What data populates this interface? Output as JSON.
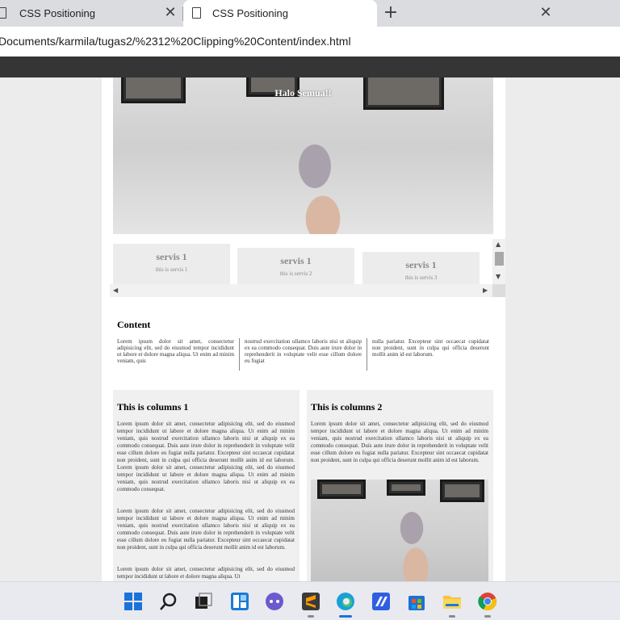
{
  "browser": {
    "tabs": [
      {
        "title": "CSS Positioning",
        "active": false
      },
      {
        "title": "CSS Positioning",
        "active": true
      }
    ],
    "close_glyph": "✕",
    "new_tab_glyph": "+",
    "url": "Documents/karmila/tugas2/%2312%20Clipping%20Content/index.html"
  },
  "page": {
    "hero_title": "Halo Semua!!",
    "services": [
      {
        "title": "servis 1",
        "subtitle": "this is servis 1"
      },
      {
        "title": "servis 1",
        "subtitle": "this is servis 2"
      },
      {
        "title": "servis 1",
        "subtitle": "this is servis 3"
      }
    ],
    "content": {
      "title": "Content",
      "columns": [
        "Lorem ipsum dolor sit amet, consectetur adipisicing elit, sed do eiusmod tempor incididunt ut labore et dolore magna aliqua. Ut enim ad minim veniam, quis",
        "nostrud exercitation ullamco laboris nisi ut aliquip ex ea commodo consequat. Duis aute irure dolor in reprehenderit in voluptate velit esse cillum dolore eu fugiat",
        "nulla pariatur. Excepteur sint occaecat cupidatat non proident, sunt in culpa qui officia deserunt mollit anim id est laborum."
      ]
    },
    "column1": {
      "title": "This is columns 1",
      "paragraphs": [
        "Lorem ipsum dolor sit amet, consectetur adipisicing elit, sed do eiusmod tempor incididunt ut labore et dolore magna aliqua. Ut enim ad minim veniam, quis nostrud exercitation ullamco laboris nisi ut aliquip ex ea commodo consequat. Duis aute irure dolor in reprehenderit in voluptate velit esse cillum dolore eu fugiat nulla pariatur. Excepteur sint occaecat cupidatat non proident, sunt in culpa qui officia deserunt mollit anim id est laborum. Lorem ipsum dolor sit amet, consectetur adipisicing elit, sed do eiusmod tempor incididunt ut labore et dolore magna aliqua. Ut enim ad minim veniam, quis nostrud exercitation ullamco laboris nisi ut aliquip ex ea commodo consequat.",
        "Lorem ipsum dolor sit amet, consectetur adipisicing elit, sed do eiusmod tempor incididunt ut labore et dolore magna aliqua. Ut enim ad minim veniam, quis nostrud exercitation ullamco laboris nisi ut aliquip ex ea commodo consequat. Duis aute irure dolor in reprehenderit in voluptate velit esse cillum dolore eu fugiat nulla pariatur. Excepteur sint occaecat cupidatat non proident, sunt in culpa qui officia deserunt mollit anim id est laborum.",
        "Lorem ipsum dolor sit amet, consectetur adipisicing elit, sed do eiusmod tempor incididunt ut labore et dolore magna aliqua. Ut"
      ]
    },
    "column2": {
      "title": "This is columns 2",
      "paragraph": "Lorem ipsum dolor sit amet, consectetur adipisicing elit, sed do eiusmod tempor incididunt ut labore et dolore magna aliqua. Ut enim ad minim veniam, quis nostrud exercitation ullamco laboris nisi ut aliquip ex ea commodo consequat. Duis aute irure dolor in reprehenderit in voluptate velit esse cillum dolore eu fugiat nulla pariatur. Excepteur sint occaecat cupidatat non proident, sunt in culpa qui officia deserunt mollit anim id est laborum."
    }
  },
  "scrollbar": {
    "up": "▲",
    "down": "▼",
    "left": "◀",
    "right": "▶"
  },
  "taskbar": {
    "icons": [
      "windows-start-icon",
      "search-icon",
      "task-view-icon",
      "widgets-icon",
      "chat-icon",
      "sublime-text-icon",
      "edge-icon",
      "visual-studio-icon",
      "microsoft-store-icon",
      "file-explorer-icon",
      "chrome-icon"
    ]
  }
}
